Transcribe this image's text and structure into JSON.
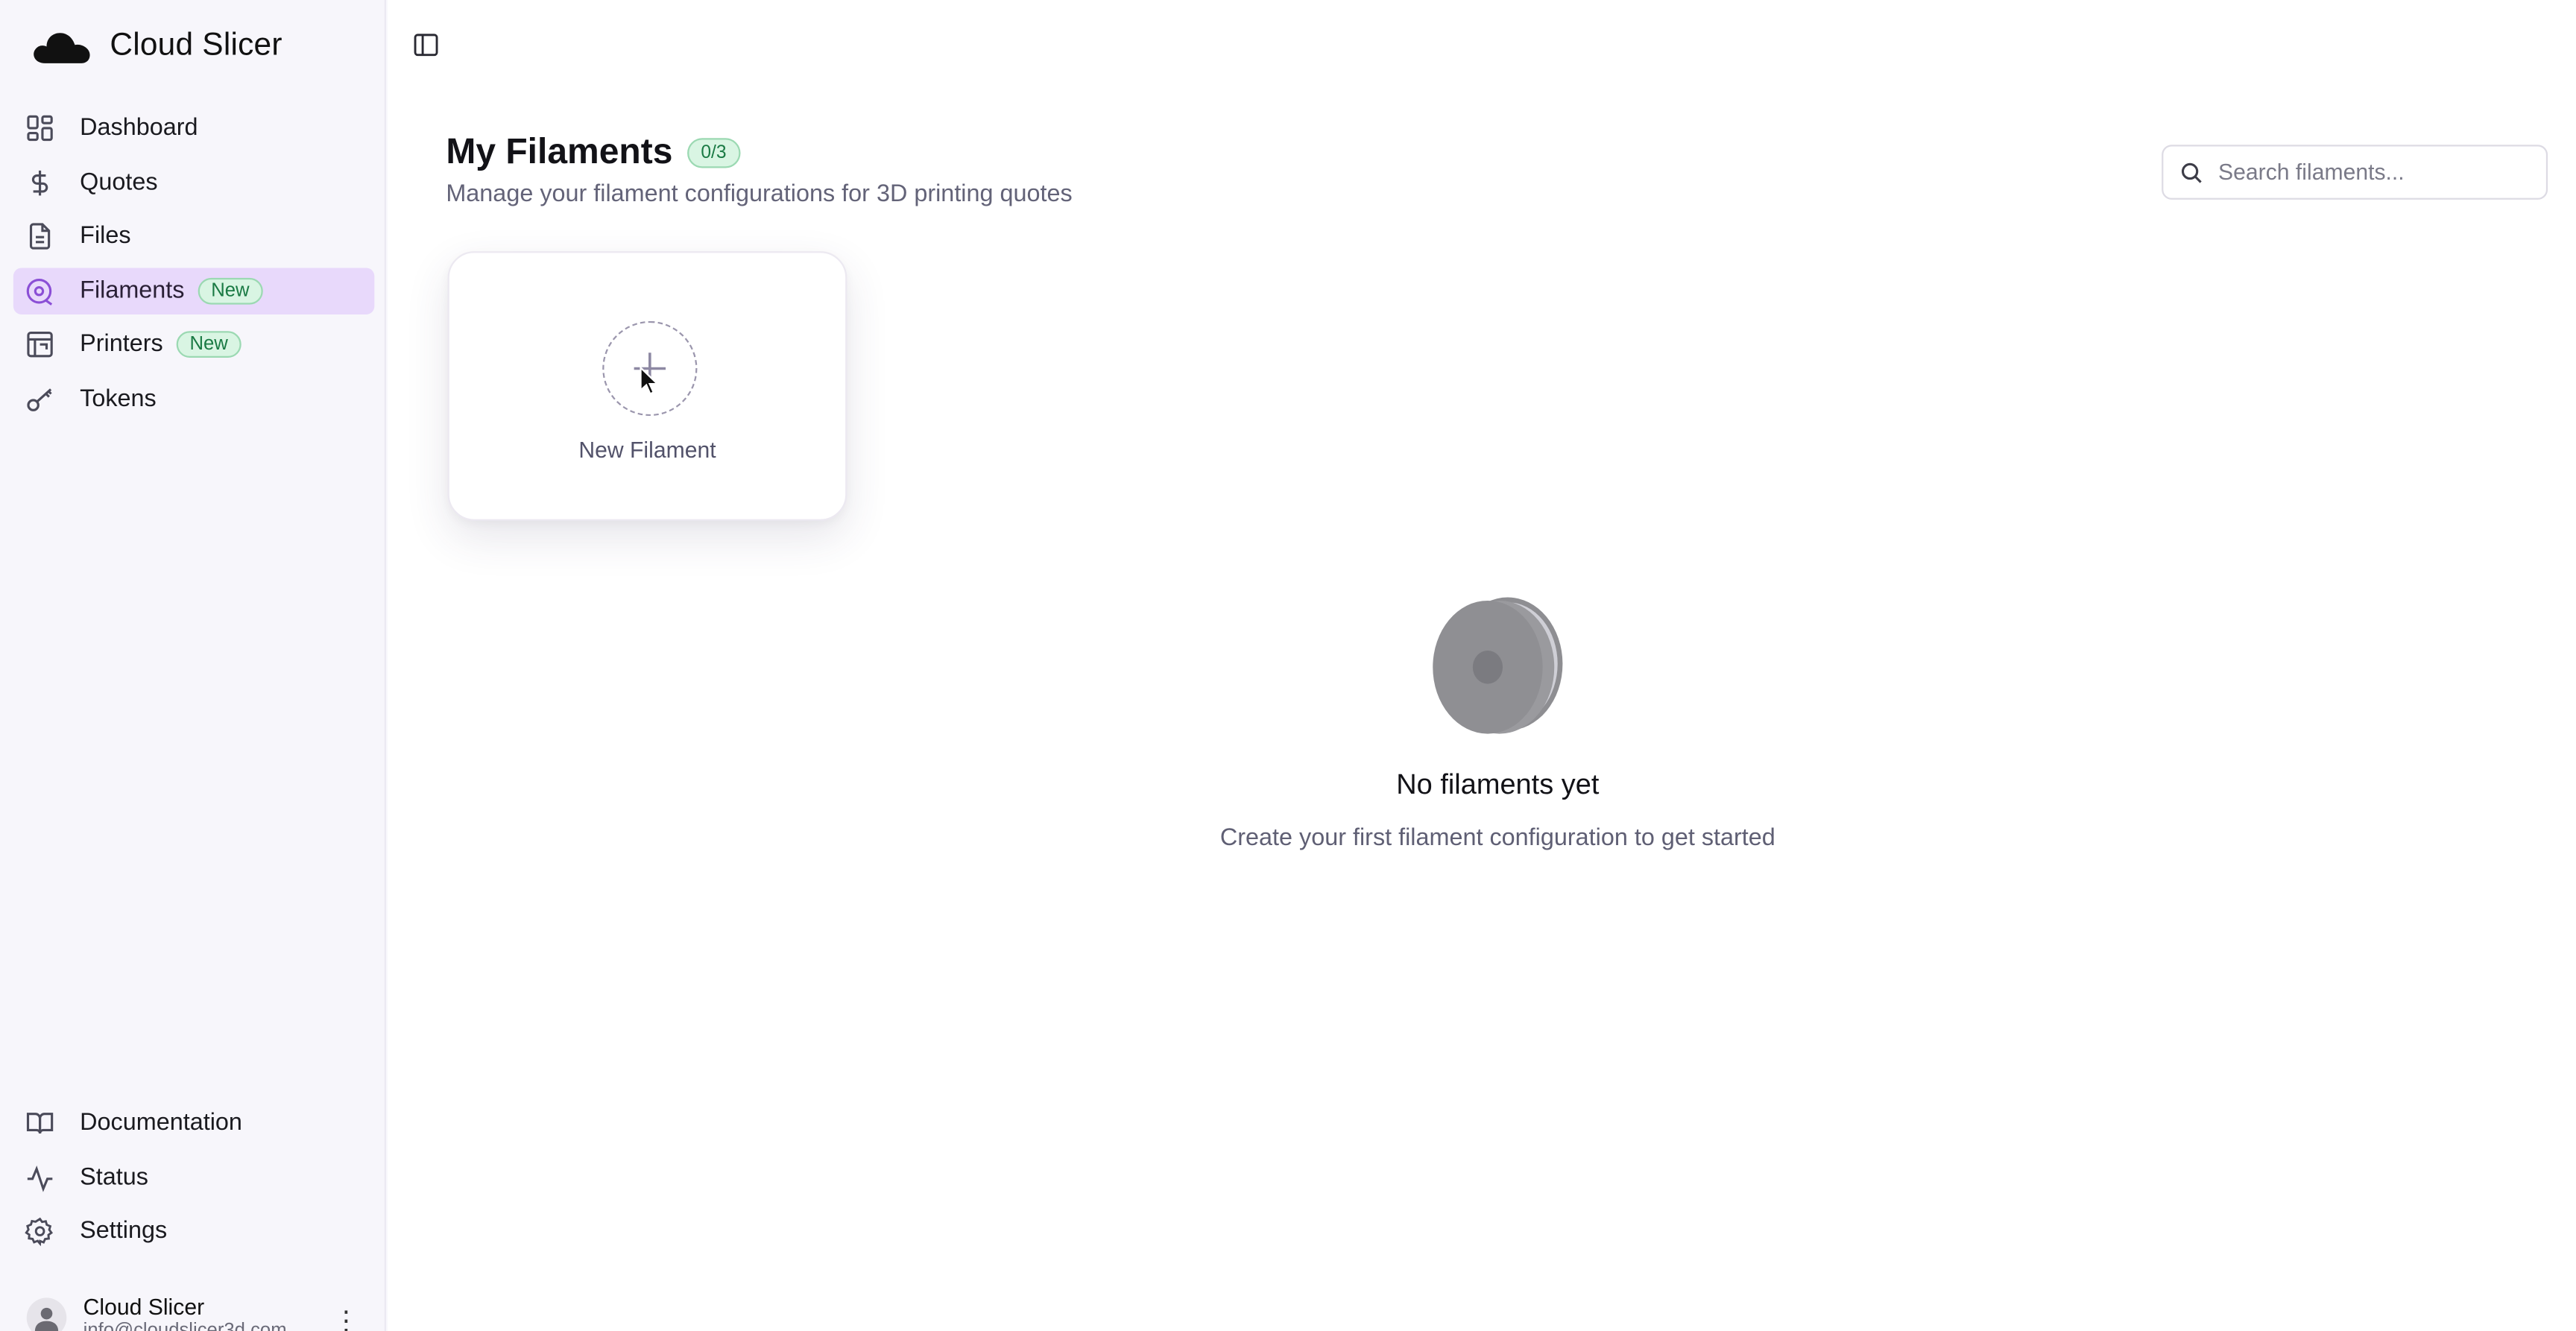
{
  "app": {
    "name": "Cloud Slicer"
  },
  "sidebar": {
    "items": [
      {
        "label": "Dashboard",
        "icon": "dashboard-icon"
      },
      {
        "label": "Quotes",
        "icon": "dollar-icon"
      },
      {
        "label": "Files",
        "icon": "file-icon"
      },
      {
        "label": "Filaments",
        "icon": "filament-icon",
        "badge": "New",
        "active": true
      },
      {
        "label": "Printers",
        "icon": "printer-icon",
        "badge": "New"
      },
      {
        "label": "Tokens",
        "icon": "key-icon"
      }
    ],
    "bottom_items": [
      {
        "label": "Documentation",
        "icon": "book-icon"
      },
      {
        "label": "Status",
        "icon": "activity-icon"
      },
      {
        "label": "Settings",
        "icon": "gear-icon"
      }
    ]
  },
  "user": {
    "name": "Cloud Slicer",
    "email": "info@cloudslicer3d.com"
  },
  "page": {
    "title": "My Filaments",
    "count_badge": "0/3",
    "subtitle": "Manage your filament configurations for 3D printing quotes",
    "search_placeholder": "Search filaments...",
    "new_card_label": "New Filament",
    "empty_title": "No filaments yet",
    "empty_description": "Create your first filament configuration to get started"
  },
  "colors": {
    "active_bg": "#e8d9fb",
    "accent": "#8b4fd6",
    "badge_green": "#1a7a44",
    "badge_green_bg": "#d9f5e3"
  }
}
